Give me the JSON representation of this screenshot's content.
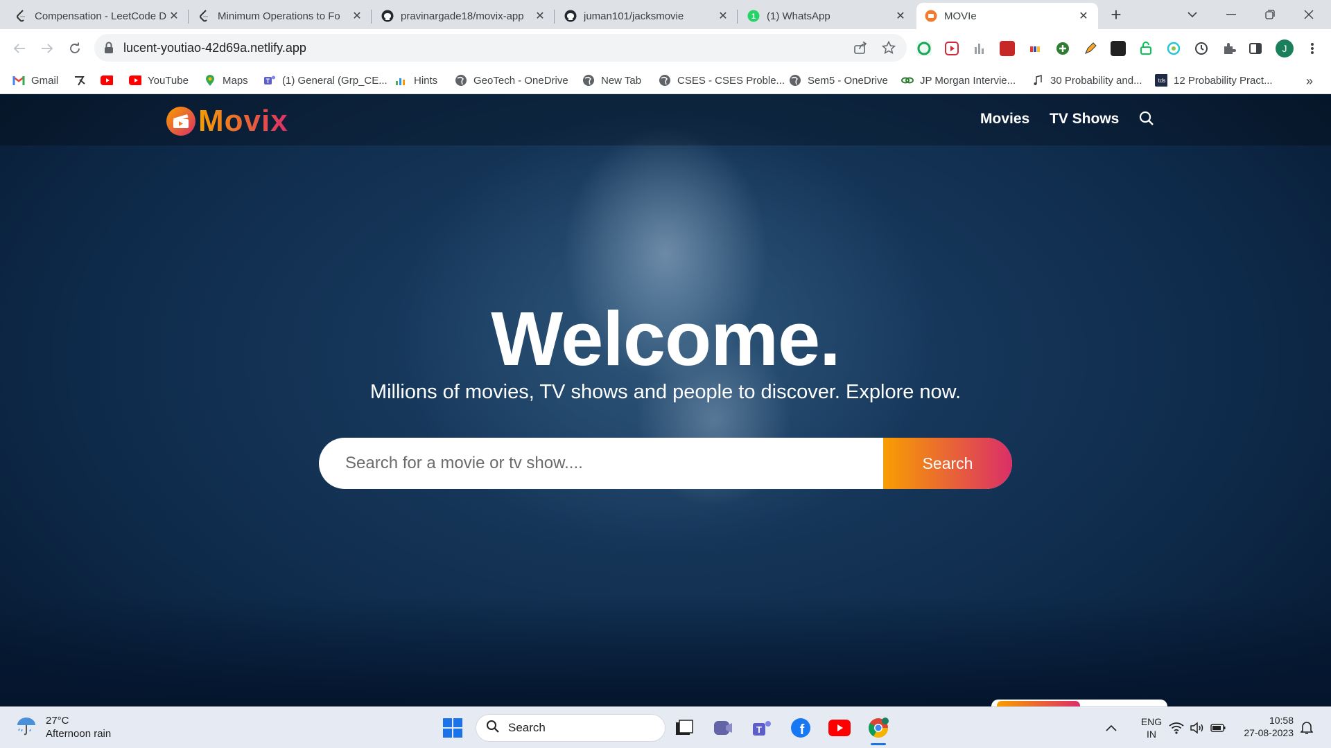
{
  "browser": {
    "tabs": [
      {
        "title": "Compensation - LeetCode D",
        "icon": "leetcode-icon"
      },
      {
        "title": "Minimum Operations to Fo",
        "icon": "leetcode-icon"
      },
      {
        "title": "pravinargade18/movix-app",
        "icon": "github-icon"
      },
      {
        "title": "juman101/jacksmovie",
        "icon": "github-icon"
      },
      {
        "title": "(1) WhatsApp",
        "icon": "whatsapp-icon"
      },
      {
        "title": "MOVIe",
        "icon": "movix-icon",
        "active": true
      }
    ],
    "new_tab": "+",
    "url": "lucent-youtiao-42d69a.netlify.app",
    "profile_initial": "J",
    "bookmarks": [
      {
        "label": "Gmail",
        "icon": "gmail-icon"
      },
      {
        "label": "",
        "icon": "bookmark-app-icon"
      },
      {
        "label": "",
        "icon": "youtube-icon"
      },
      {
        "label": "YouTube",
        "icon": "youtube-icon"
      },
      {
        "label": "Maps",
        "icon": "maps-icon"
      },
      {
        "label": "(1) General (Grp_CE...",
        "icon": "teams-icon"
      },
      {
        "label": "Hints",
        "icon": "hints-icon"
      },
      {
        "label": "GeoTech - OneDrive",
        "icon": "globe-icon"
      },
      {
        "label": "New Tab",
        "icon": "globe-icon"
      },
      {
        "label": "CSES - CSES Proble...",
        "icon": "globe-icon"
      },
      {
        "label": "Sem5 - OneDrive",
        "icon": "globe-icon"
      },
      {
        "label": "JP Morgan Intervie...",
        "icon": "jpmorgan-icon"
      },
      {
        "label": "30 Probability and...",
        "icon": "music-icon"
      },
      {
        "label": "12 Probability Pract...",
        "icon": "tds-icon"
      }
    ],
    "more_bookmarks": "»"
  },
  "site": {
    "brand": "Movix",
    "menu": [
      "Movies",
      "TV Shows"
    ],
    "hero": {
      "title": "Welcome.",
      "subtitle": "Millions of movies, TV shows and people to discover. Explore now.",
      "search_placeholder": "Search for a movie or tv show....",
      "search_button": "Search"
    },
    "colors": {
      "background": "#04152d",
      "gradient_start": "#f89e00",
      "gradient_end": "#da2f68"
    }
  },
  "taskbar": {
    "weather": {
      "temp": "27°C",
      "desc": "Afternoon rain"
    },
    "search_label": "Search",
    "language": {
      "line1": "ENG",
      "line2": "IN"
    },
    "time": "10:58",
    "date": "27-08-2023"
  }
}
